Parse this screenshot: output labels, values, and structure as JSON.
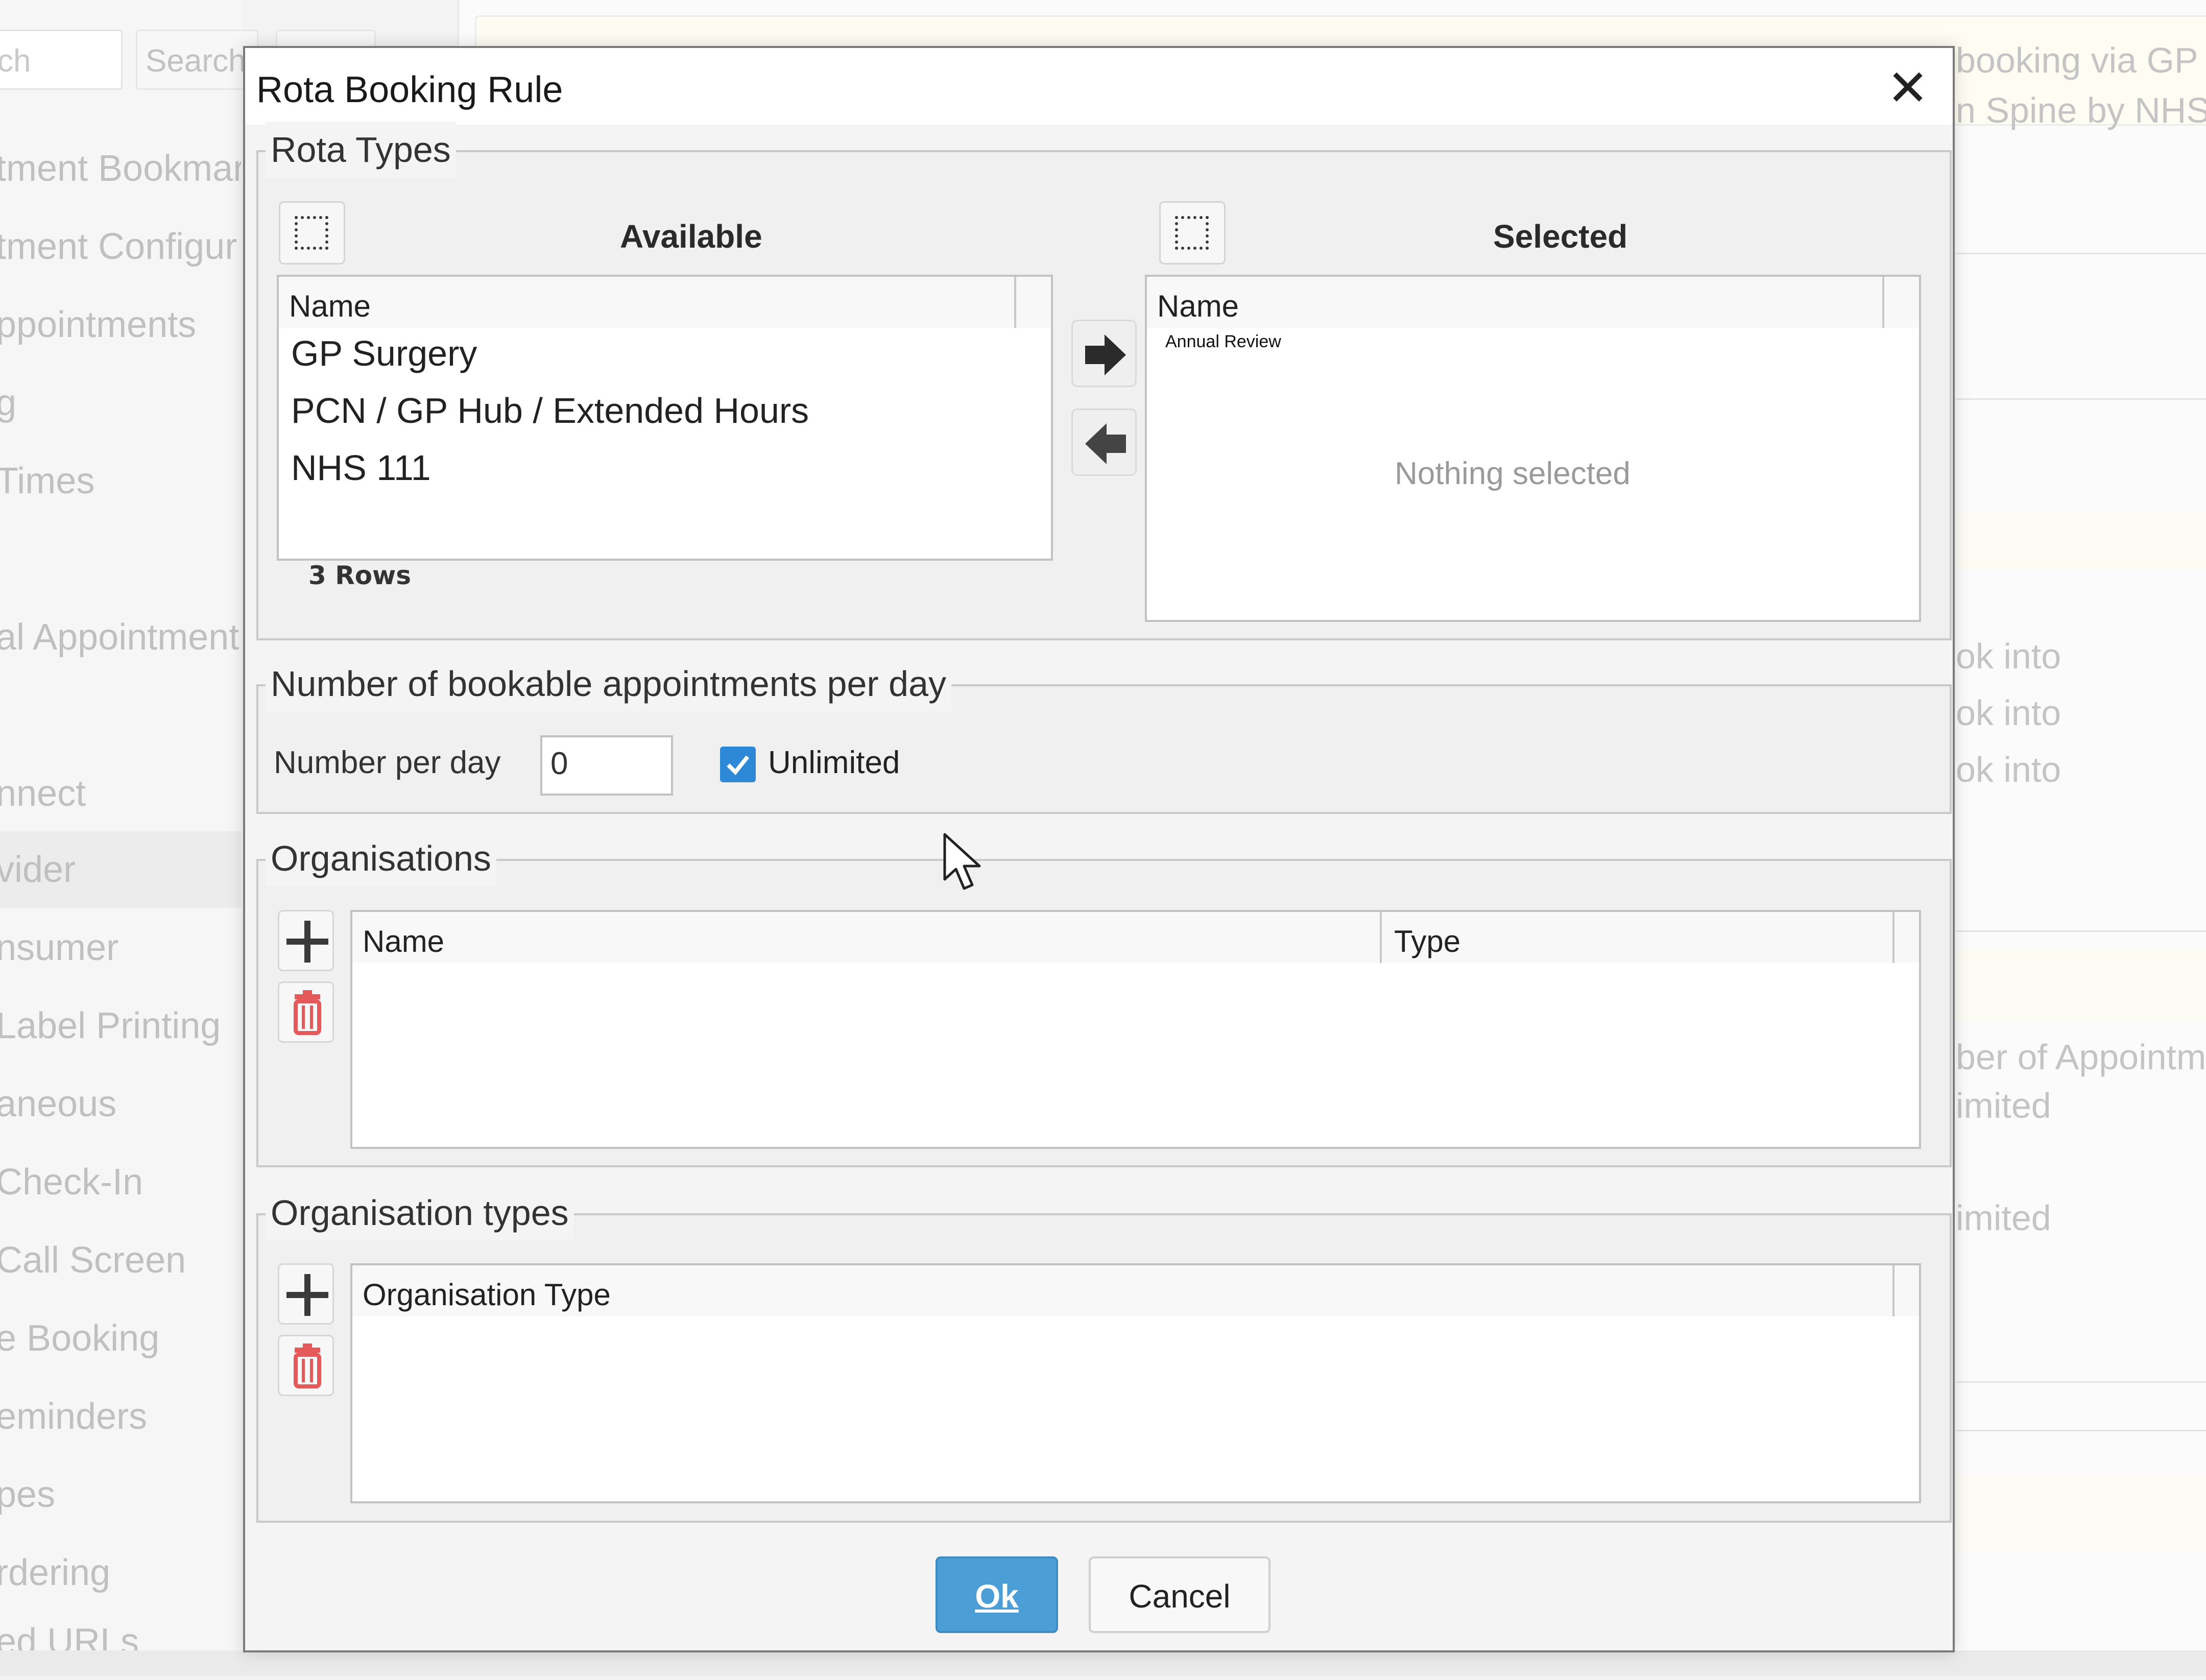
{
  "background": {
    "search_input_text": "ch",
    "search_button_label": "Search",
    "nav_items": [
      "tment Bookmar",
      "tment Configur",
      "ppointments",
      "g",
      "Times",
      "",
      "al Appointment",
      "",
      "nnect",
      "vider",
      "nsumer",
      "Label Printing",
      "aneous",
      "Check-In",
      "Call Screen",
      "e Booking",
      "eminders",
      "pes",
      "rdering",
      "ed URLs"
    ],
    "right_texts": {
      "booking_line": "booking via GP",
      "spine_line": "n Spine by NHS",
      "book_into_1": "ok into",
      "book_into_2": "ok into",
      "book_into_3": "ok into",
      "number_of_appointments": "ber of Appointme",
      "unlimited_1": "imited",
      "unlimited_2": "imited"
    }
  },
  "dialog": {
    "title": "Rota Booking Rule",
    "close_glyph": "✕",
    "rota_types": {
      "legend": "Rota Types",
      "available": {
        "title": "Available",
        "column": "Name",
        "rows": [
          "GP Surgery",
          "PCN / GP Hub / Extended Hours",
          "NHS 111"
        ],
        "row_count": "3 Rows"
      },
      "selected": {
        "title": "Selected",
        "column": "Name",
        "overlay_text": "Annual Review",
        "empty_text": "Nothing selected"
      }
    },
    "bookable": {
      "legend": "Number of bookable appointments per day",
      "label": "Number per day",
      "value": "0",
      "unlimited_label": "Unlimited",
      "unlimited_checked": true
    },
    "organisations": {
      "legend": "Organisations",
      "columns": [
        "Name",
        "Type"
      ]
    },
    "organisation_types": {
      "legend": "Organisation types",
      "columns": [
        "Organisation Type"
      ]
    },
    "buttons": {
      "ok": "Ok",
      "cancel": "Cancel"
    }
  },
  "colors": {
    "accent": "#2d89d6",
    "ok_button": "#4c9fd6",
    "delete_icon": "#e45a5a"
  }
}
